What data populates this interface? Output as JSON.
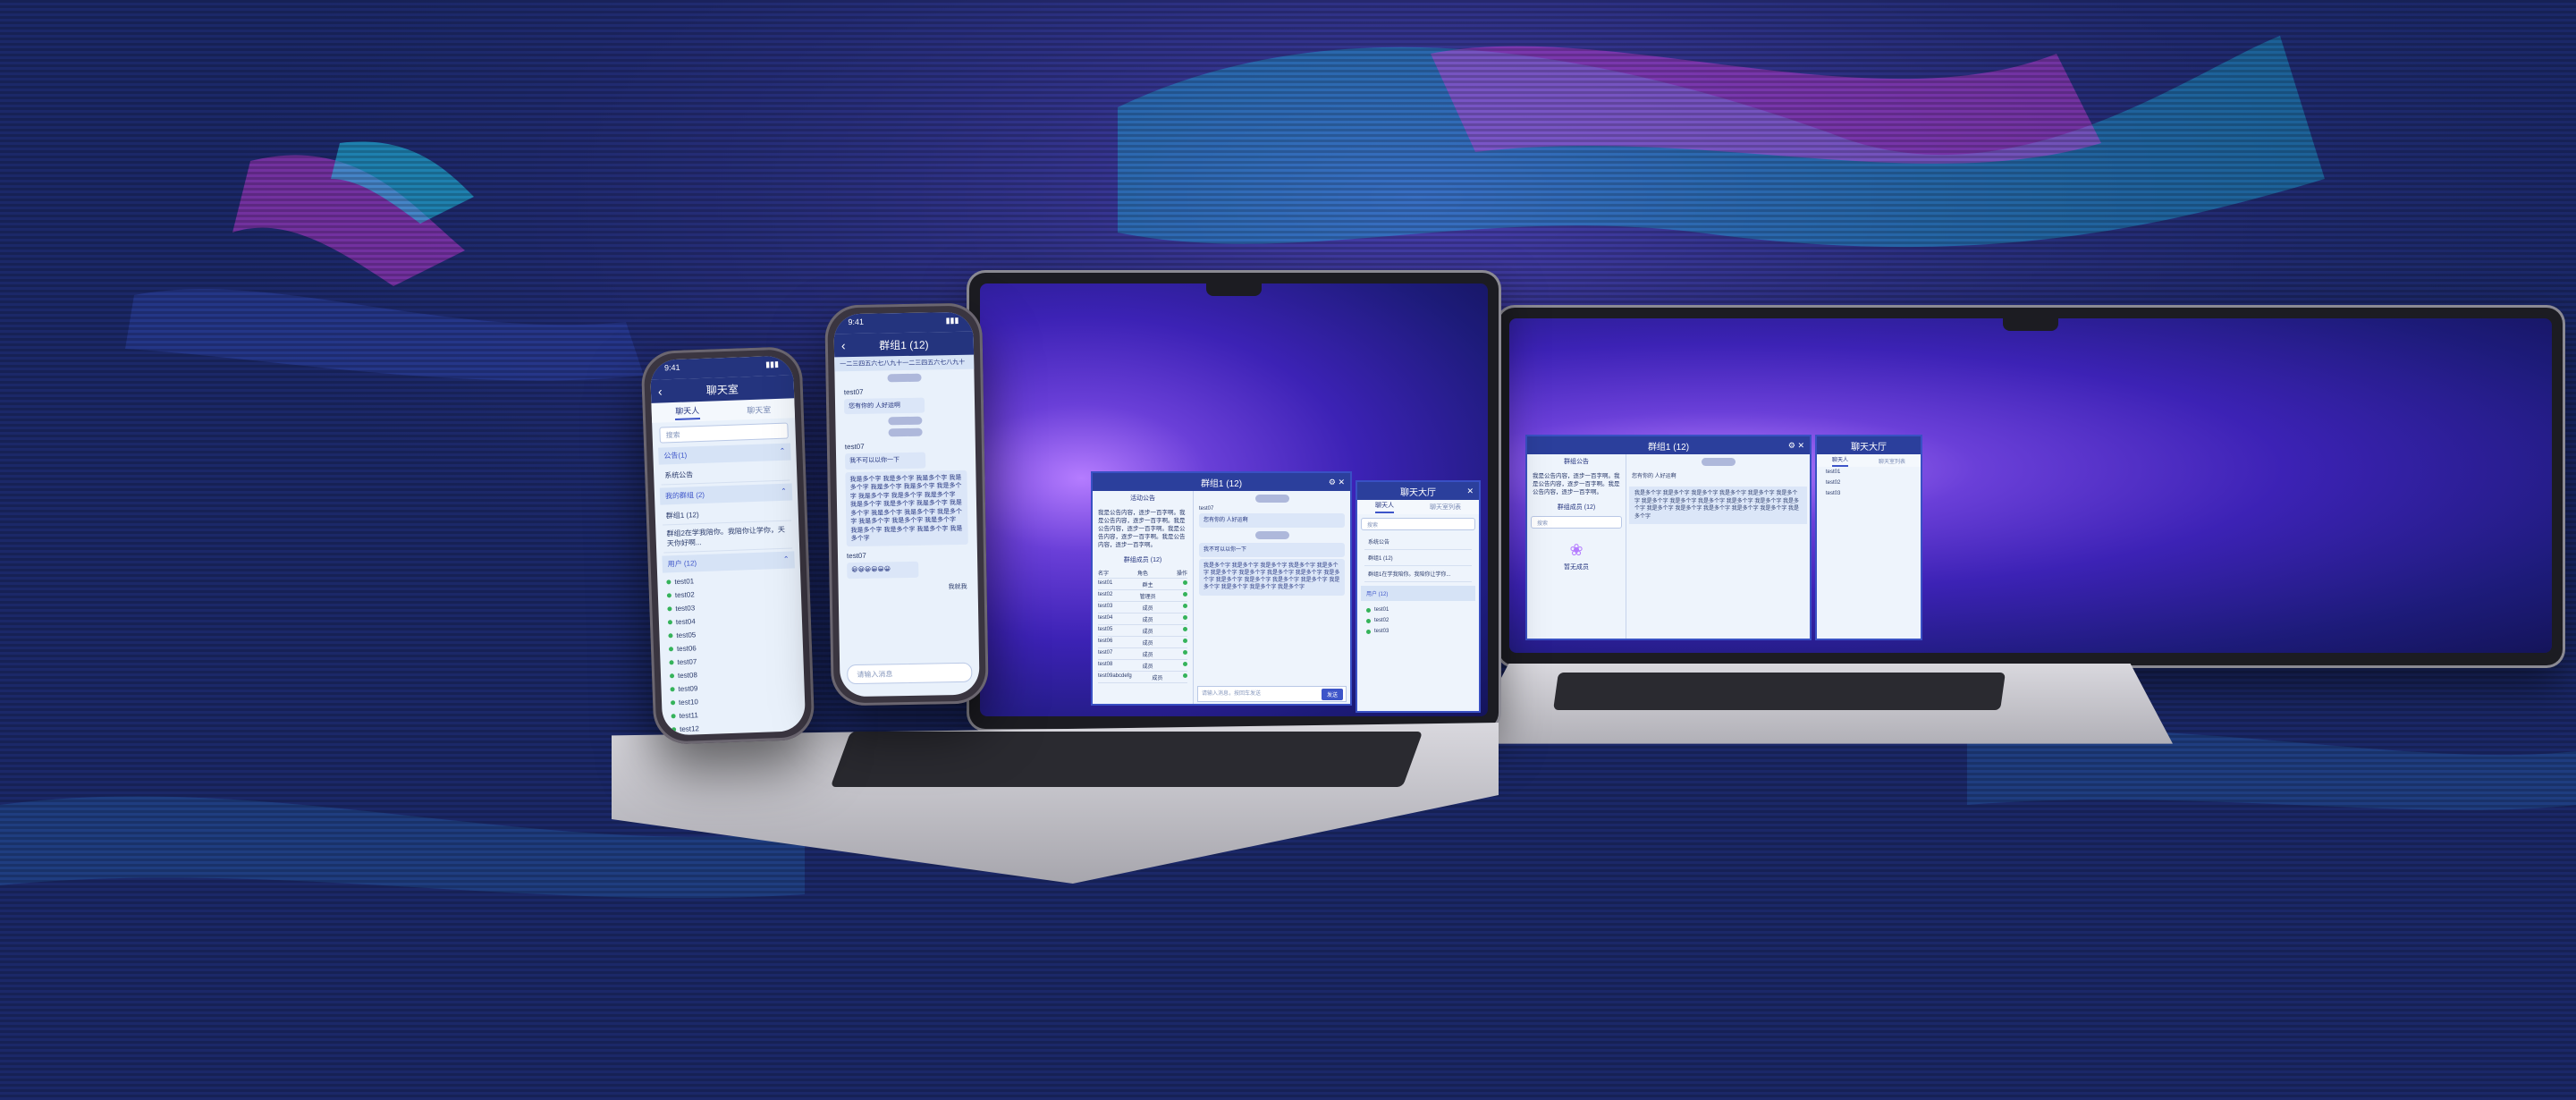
{
  "colors": {
    "accent": "#2b3f9c",
    "background": "#1a2766",
    "online": "#35b35a"
  },
  "phone_left": {
    "status_time": "9:41",
    "title": "聊天室",
    "tabs": [
      "聊天人",
      "聊天室"
    ],
    "search_placeholder": "搜索",
    "sections": [
      {
        "label": "公告(1)"
      },
      {
        "label": "我的群组 (2)"
      },
      {
        "label": "用户 (12)"
      }
    ],
    "rows": [
      "系统公告",
      "群组1 (12)",
      "群组2在学我陪你。我陪你让学你，天天你好啊..."
    ],
    "users": [
      "test01",
      "test02",
      "test03",
      "test04",
      "test05",
      "test06",
      "test07",
      "test08",
      "test09",
      "test10",
      "test11",
      "test12"
    ]
  },
  "phone_right": {
    "status_time": "9:41",
    "title": "群组1 (12)",
    "notice": "一二三四五六七八九十一二三四五六七八九十",
    "msg1_user": "test07",
    "msg1_text": "您有你的 人好运啊",
    "msg2_user": "test07",
    "msg2_text": "我不可以以你一下",
    "long_text": "我是多个字 我是多个字 我是多个字 我是多个字 我是多个字 我是多个字 我是多个字 我是多个字 我是多个字 我是多个字 我是多个字 我是多个字 我是多个字 我是多个字 我是多个字 我是多个字 我是多个字 我是多个字 我是多个字 我是多个字 我是多个字 我是多个字 我是多个字 我是多个字",
    "msg3_user": "test07",
    "emoji_text": "😀😀😀😀😀😀",
    "self_label": "我就我",
    "input_placeholder": "请输入消息"
  },
  "laptop_main": {
    "group_window": {
      "title": "群组1 (12)",
      "announce_head": "活动公告",
      "announce_text": "我是公告内容，逐步一百字啊。我是公告内容，逐步一百字啊。我是公告内容，逐步一百字啊。我是公告内容，逐步一百字啊。我是公告内容，逐步一百字啊。",
      "members_head": "群组成员 (12)",
      "member_cols": [
        "名字",
        "角色",
        "操作"
      ],
      "members": [
        {
          "name": "test01",
          "role": "群主"
        },
        {
          "name": "test02",
          "role": "管理员"
        },
        {
          "name": "test03",
          "role": "成员"
        },
        {
          "name": "test04",
          "role": "成员"
        },
        {
          "name": "test05",
          "role": "成员"
        },
        {
          "name": "test06",
          "role": "成员"
        },
        {
          "name": "test07",
          "role": "成员"
        },
        {
          "name": "test08",
          "role": "成员"
        },
        {
          "name": "test09abcdefg",
          "role": "成员"
        }
      ],
      "msg_user": "test07",
      "msg_text": "您有你的 人好运啊",
      "msg2_text": "我不可以以你一下",
      "long_text": "我是多个字 我是多个字 我是多个字 我是多个字 我是多个字 我是多个字 我是多个字 我是多个字 我是多个字 我是多个字 我是多个字 我是多个字 我是多个字 我是多个字 我是多个字 我是多个字 我是多个字 我是多个字",
      "input_placeholder": "请输入消息，按回车发送",
      "send_label": "发送"
    },
    "hall_window": {
      "title": "聊天大厅",
      "tabs": [
        "聊天人",
        "聊天室列表"
      ],
      "search_placeholder": "搜索",
      "items": [
        "系统公告",
        "群组1 (12)",
        "群组1在学我陪你。我陪你让学你..."
      ],
      "users_head": "用户 (12)",
      "users": [
        "test01",
        "test02",
        "test03"
      ]
    }
  },
  "laptop_right": {
    "group_window": {
      "title": "群组1 (12)",
      "announce_head": "群组公告",
      "announce_text": "我是公告内容，逐步一百字啊。我是公告内容，逐步一百字啊。我是公告内容，逐步一百字啊。",
      "members_head": "群组成员 (12)",
      "search_placeholder": "搜索",
      "empty_label": "暂无成员"
    },
    "hall_window": {
      "title": "聊天大厅",
      "tabs": [
        "聊天人",
        "聊天室列表"
      ],
      "items": [
        "test01",
        "test02",
        "test03"
      ]
    }
  }
}
